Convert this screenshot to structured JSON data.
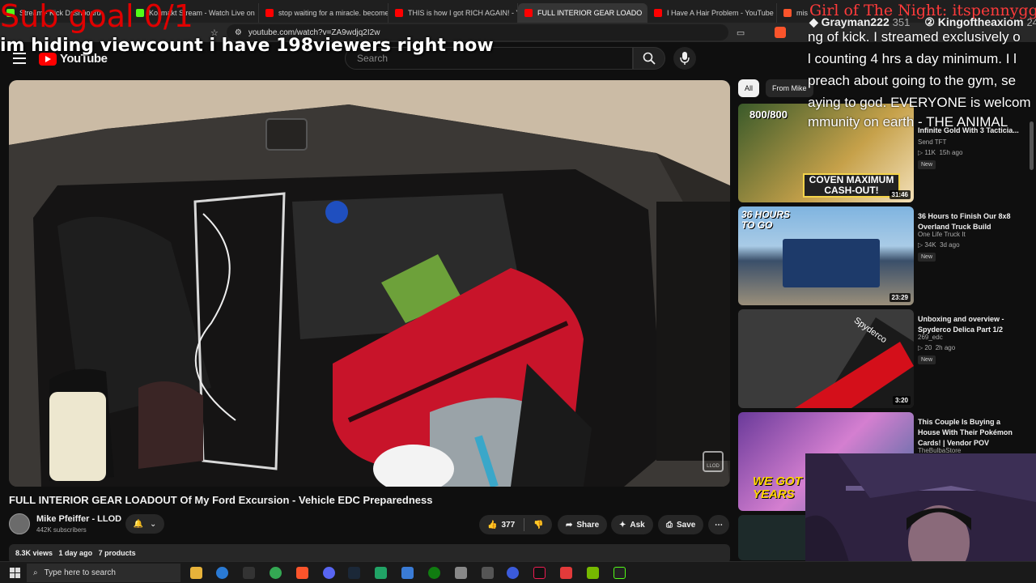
{
  "colors": {
    "youtube_red": "#ff0000",
    "overlay_red": "#e00000",
    "background": "#0f0f0f",
    "chip_bg": "#272727"
  },
  "browser": {
    "tabs": [
      {
        "label": "Stream - Kick Dashboard",
        "favicon": "kick-icon",
        "color": "#53fc18",
        "active": false
      },
      {
        "label": "Kollmakt Stream - Watch Live on",
        "favicon": "kick-icon",
        "color": "#53fc18",
        "active": false
      },
      {
        "label": "stop waiting for a miracle. become",
        "favicon": "youtube-icon",
        "color": "#ff0000",
        "active": false
      },
      {
        "label": "THIS is how I got RICH AGAIN! - Yo",
        "favicon": "youtube-icon",
        "color": "#ff0000",
        "active": false
      },
      {
        "label": "FULL INTERIOR GEAR LOADO",
        "favicon": "youtube-icon",
        "color": "#ff0000",
        "active": true
      },
      {
        "label": "I Have A Hair Problem - YouTube",
        "favicon": "youtube-icon",
        "color": "#ff0000",
        "active": false
      },
      {
        "label": "mis",
        "favicon": "brave-icon",
        "color": "#fb542b",
        "active": false
      }
    ],
    "url": "youtube.com/watch?v=ZA9wdjq2I2w"
  },
  "youtube": {
    "logo_text": "YouTube",
    "search_placeholder": "Search",
    "video": {
      "title": "FULL INTERIOR GEAR LOADOUT Of My Ford Excursion - Vehicle EDC Preparedness",
      "channel": "Mike Pfeiffer - LLOD",
      "subscribers": "442K subscribers",
      "likes": "377",
      "share_label": "Share",
      "ask_label": "Ask",
      "save_label": "Save",
      "views": "8.3K views",
      "age": "1 day ago",
      "products": "7 products",
      "watermark": "LLOD"
    },
    "chips": [
      "All",
      "From Mike"
    ],
    "recommendations": [
      {
        "title": "Infinite Gold With 3 Tacticia...",
        "channel": "Send TFT",
        "views": "11K",
        "age": "15h ago",
        "badge": "New",
        "duration": "31:46",
        "thumb_text_top": "800/800",
        "thumb_text_bottom": "COVEN MAXIMUM CASH-OUT!"
      },
      {
        "title": "36 Hours to Finish Our 8x8 Overland Truck Build",
        "channel": "One Life Truck It",
        "views": "34K",
        "age": "3d ago",
        "badge": "New",
        "duration": "23:29",
        "thumb_text_top": "36 HOURS TO GO"
      },
      {
        "title": "Unboxing and overview - Spyderco Delica Part 1/2",
        "channel": "269_edc",
        "views": "20",
        "age": "2h ago",
        "badge": "New",
        "duration": "3:20",
        "thumb_text_top": "Spyderco"
      },
      {
        "title": "This Couple Is Buying a House With Their Pokémon Cards! | Vendor POV",
        "channel": "TheBulbaStore",
        "thumb_text_bottom": "WE GOT 6 YEARS"
      }
    ]
  },
  "overlay": {
    "sub_goal": "Sub goal 0/1",
    "viewcount_text": "im hiding viewcount i have 198viewers right now",
    "banner": "Girl of The Night: itspennygg",
    "chat_users": [
      {
        "name": "Grayman222",
        "count": "351"
      },
      {
        "name": "Kingoftheaxiom",
        "count": "24"
      }
    ],
    "chat_lines": [
      "ng of kick. I streamed exclusively o",
      "l counting 4 hrs a day minimum. I l",
      "preach about going to the gym, se",
      "aying to god. EVERYONE is welcom",
      "mmunity on earth - THE ANIMAL"
    ]
  },
  "taskbar": {
    "search_placeholder": "Type here to search"
  }
}
